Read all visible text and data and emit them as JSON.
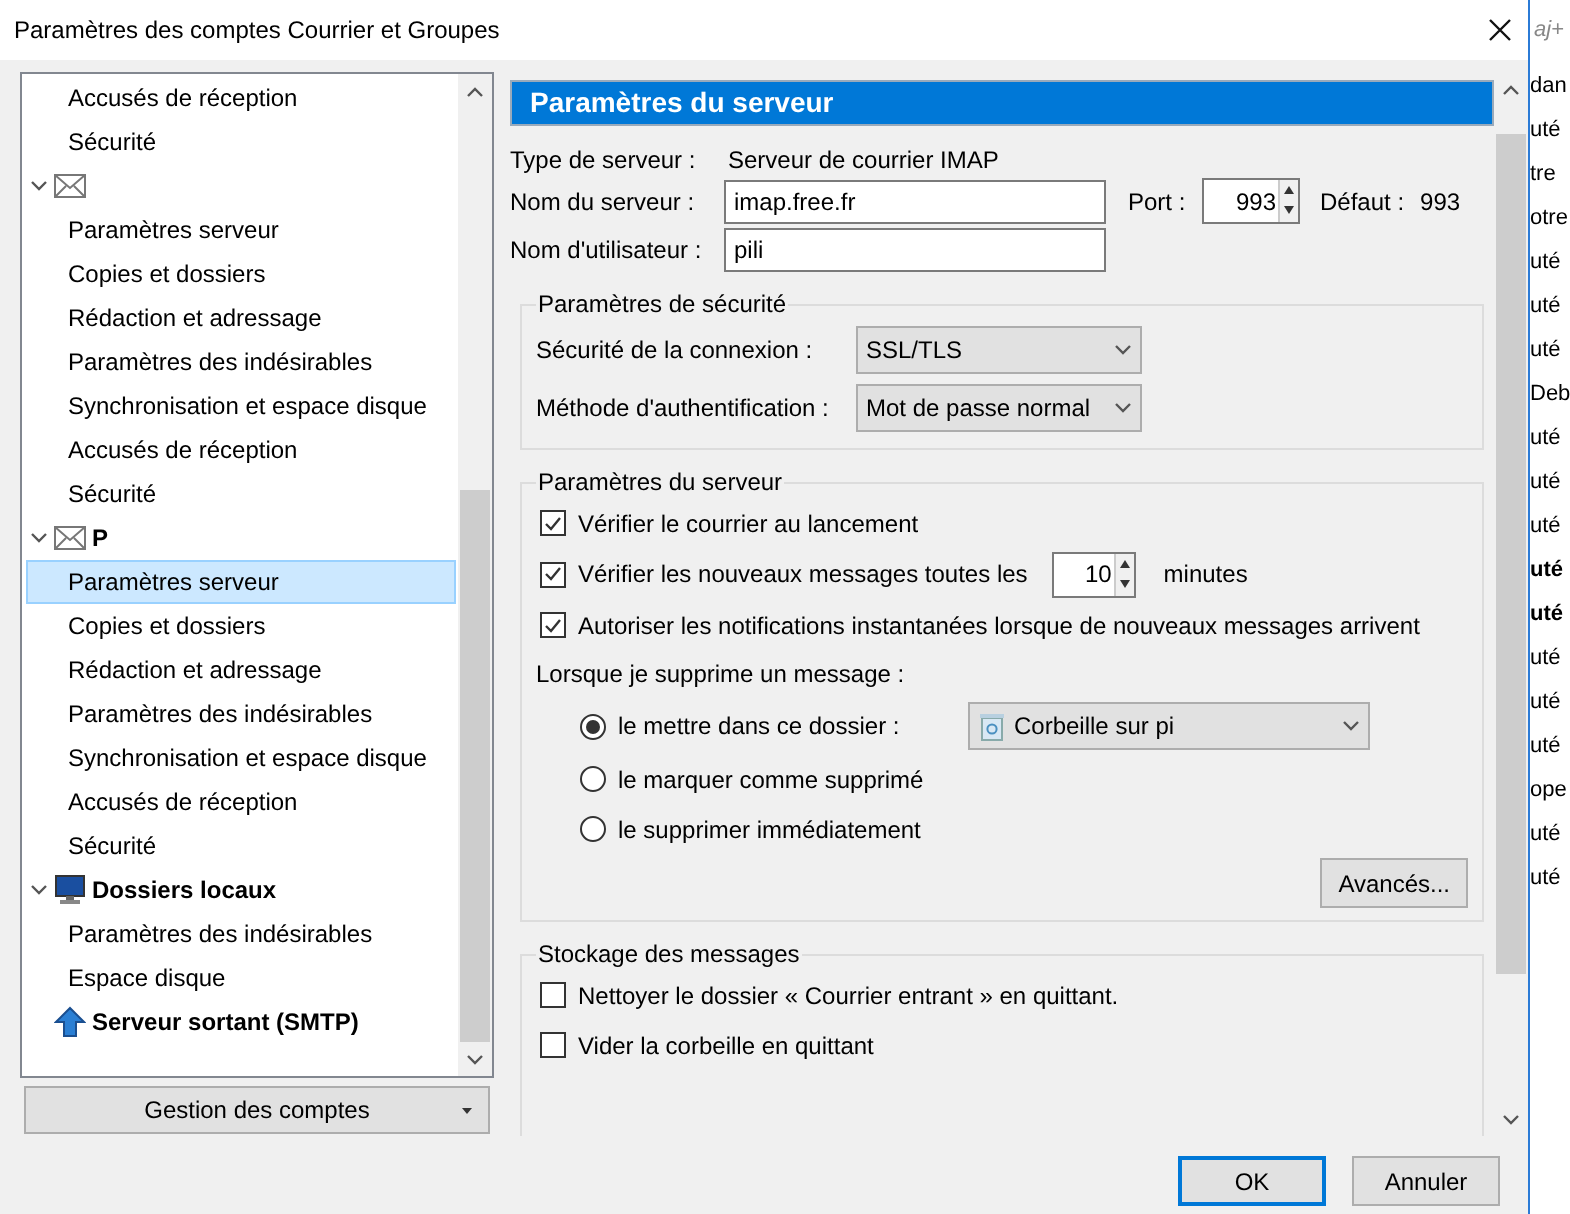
{
  "window": {
    "title": "Paramètres des comptes Courrier et Groupes"
  },
  "tree": [
    {
      "kind": "scrolled",
      "children": [
        {
          "label": "Accusés de réception",
          "selected": false
        },
        {
          "label": "Sécurité",
          "selected": false
        }
      ]
    },
    {
      "kind": "mail",
      "expanded": true,
      "children": [
        {
          "label": "Paramètres serveur",
          "selected": false
        },
        {
          "label": "Copies et dossiers",
          "selected": false
        },
        {
          "label": "Rédaction et adressage",
          "selected": false
        },
        {
          "label": "Paramètres des indésirables",
          "selected": false
        },
        {
          "label": "Synchronisation et espace disque",
          "selected": false
        },
        {
          "label": "Accusés de réception",
          "selected": false
        },
        {
          "label": "Sécurité",
          "selected": false
        }
      ]
    },
    {
      "kind": "mail",
      "label": "P",
      "expanded": true,
      "children": [
        {
          "label": "Paramètres serveur",
          "selected": true
        },
        {
          "label": "Copies et dossiers",
          "selected": false
        },
        {
          "label": "Rédaction et adressage",
          "selected": false
        },
        {
          "label": "Paramètres des indésirables",
          "selected": false
        },
        {
          "label": "Synchronisation et espace disque",
          "selected": false
        },
        {
          "label": "Accusés de réception",
          "selected": false
        },
        {
          "label": "Sécurité",
          "selected": false
        }
      ]
    },
    {
      "kind": "local",
      "label": "Dossiers locaux",
      "expanded": true,
      "children": [
        {
          "label": "Paramètres des indésirables",
          "selected": false
        },
        {
          "label": "Espace disque",
          "selected": false
        }
      ]
    },
    {
      "kind": "smtp",
      "label": "Serveur sortant (SMTP)"
    }
  ],
  "account_actions_button": "Gestion des comptes",
  "panel": {
    "header": "Paramètres du serveur",
    "server_type_label": "Type de serveur :",
    "server_type": "Serveur de courrier IMAP",
    "server_name_label": "Nom du serveur :",
    "server_name": "imap.free.fr",
    "port_label": "Port :",
    "port": "993",
    "default_label": "Défaut :",
    "default_port": "993",
    "username_label": "Nom d'utilisateur :",
    "username": "pili",
    "security": {
      "title": "Paramètres de sécurité",
      "rows": [
        {
          "label": "Sécurité de la connexion :",
          "value": "SSL/TLS"
        },
        {
          "label": "Méthode d'authentification :",
          "value": "Mot de passe normal"
        }
      ]
    },
    "server": {
      "title": "Paramètres du serveur",
      "options": [
        {
          "kind": "checkbox",
          "label": "Vérifier le courrier au lancement",
          "checked": true
        },
        {
          "kind": "checkbox_interval",
          "label": "Vérifier les nouveaux messages toutes les",
          "checked": true,
          "value": "10",
          "unit": "minutes"
        },
        {
          "kind": "checkbox",
          "label": "Autoriser les notifications instantanées lorsque de nouveaux messages arrivent",
          "checked": true
        },
        {
          "kind": "heading",
          "label": "Lorsque je supprime un message :"
        },
        {
          "kind": "radio_folder",
          "label": "le mettre dans ce dossier :",
          "selected": true,
          "folder": "Corbeille sur pi"
        },
        {
          "kind": "radio",
          "label": "le marquer comme supprimé",
          "selected": false
        },
        {
          "kind": "radio",
          "label": "le supprimer immédiatement",
          "selected": false
        }
      ],
      "advanced_button": "Avancés..."
    },
    "storage": {
      "title": "Stockage des messages",
      "options": [
        {
          "label": "Nettoyer le dossier « Courrier entrant » en quittant.",
          "checked": false
        },
        {
          "label": "Vider la corbeille en quittant",
          "checked": false
        }
      ]
    }
  },
  "buttons": [
    {
      "label": "OK",
      "default": true
    },
    {
      "label": "Annuler",
      "default": false
    }
  ],
  "background_window": {
    "search_hint": "aj+",
    "fragments": [
      {
        "text": "dan",
        "bold": false
      },
      {
        "text": "uté",
        "bold": false
      },
      {
        "text": "tre",
        "bold": false
      },
      {
        "text": "otre",
        "bold": false
      },
      {
        "text": "uté",
        "bold": false
      },
      {
        "text": "uté",
        "bold": false
      },
      {
        "text": "uté",
        "bold": false
      },
      {
        "text": "Deb",
        "bold": false
      },
      {
        "text": "uté",
        "bold": false
      },
      {
        "text": "uté",
        "bold": false
      },
      {
        "text": "uté",
        "bold": false
      },
      {
        "text": "uté",
        "bold": true
      },
      {
        "text": "uté",
        "bold": true
      },
      {
        "text": "uté",
        "bold": false
      },
      {
        "text": "uté",
        "bold": false
      },
      {
        "text": "uté",
        "bold": false
      },
      {
        "text": "ope",
        "bold": false
      },
      {
        "text": "uté",
        "bold": false
      },
      {
        "text": "uté",
        "bold": false
      }
    ]
  }
}
